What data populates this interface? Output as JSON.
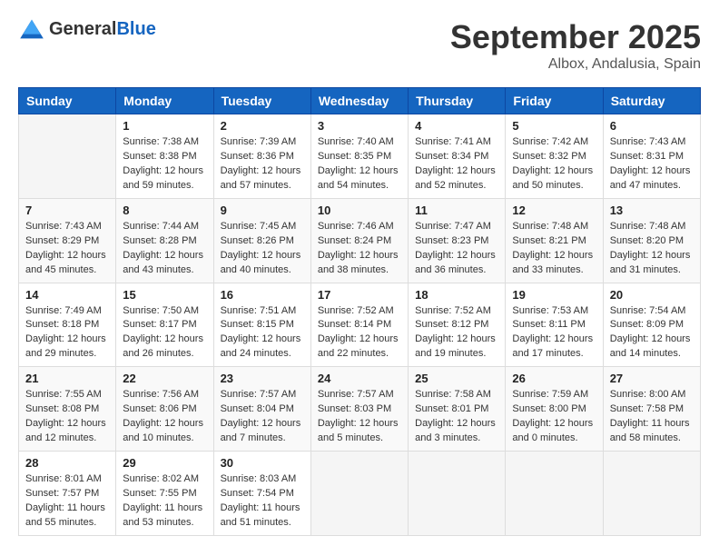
{
  "header": {
    "logo_general": "General",
    "logo_blue": "Blue",
    "month_title": "September 2025",
    "location": "Albox, Andalusia, Spain"
  },
  "days_of_week": [
    "Sunday",
    "Monday",
    "Tuesday",
    "Wednesday",
    "Thursday",
    "Friday",
    "Saturday"
  ],
  "weeks": [
    [
      {
        "day": "",
        "info": ""
      },
      {
        "day": "1",
        "info": "Sunrise: 7:38 AM\nSunset: 8:38 PM\nDaylight: 12 hours\nand 59 minutes."
      },
      {
        "day": "2",
        "info": "Sunrise: 7:39 AM\nSunset: 8:36 PM\nDaylight: 12 hours\nand 57 minutes."
      },
      {
        "day": "3",
        "info": "Sunrise: 7:40 AM\nSunset: 8:35 PM\nDaylight: 12 hours\nand 54 minutes."
      },
      {
        "day": "4",
        "info": "Sunrise: 7:41 AM\nSunset: 8:34 PM\nDaylight: 12 hours\nand 52 minutes."
      },
      {
        "day": "5",
        "info": "Sunrise: 7:42 AM\nSunset: 8:32 PM\nDaylight: 12 hours\nand 50 minutes."
      },
      {
        "day": "6",
        "info": "Sunrise: 7:43 AM\nSunset: 8:31 PM\nDaylight: 12 hours\nand 47 minutes."
      }
    ],
    [
      {
        "day": "7",
        "info": "Sunrise: 7:43 AM\nSunset: 8:29 PM\nDaylight: 12 hours\nand 45 minutes."
      },
      {
        "day": "8",
        "info": "Sunrise: 7:44 AM\nSunset: 8:28 PM\nDaylight: 12 hours\nand 43 minutes."
      },
      {
        "day": "9",
        "info": "Sunrise: 7:45 AM\nSunset: 8:26 PM\nDaylight: 12 hours\nand 40 minutes."
      },
      {
        "day": "10",
        "info": "Sunrise: 7:46 AM\nSunset: 8:24 PM\nDaylight: 12 hours\nand 38 minutes."
      },
      {
        "day": "11",
        "info": "Sunrise: 7:47 AM\nSunset: 8:23 PM\nDaylight: 12 hours\nand 36 minutes."
      },
      {
        "day": "12",
        "info": "Sunrise: 7:48 AM\nSunset: 8:21 PM\nDaylight: 12 hours\nand 33 minutes."
      },
      {
        "day": "13",
        "info": "Sunrise: 7:48 AM\nSunset: 8:20 PM\nDaylight: 12 hours\nand 31 minutes."
      }
    ],
    [
      {
        "day": "14",
        "info": "Sunrise: 7:49 AM\nSunset: 8:18 PM\nDaylight: 12 hours\nand 29 minutes."
      },
      {
        "day": "15",
        "info": "Sunrise: 7:50 AM\nSunset: 8:17 PM\nDaylight: 12 hours\nand 26 minutes."
      },
      {
        "day": "16",
        "info": "Sunrise: 7:51 AM\nSunset: 8:15 PM\nDaylight: 12 hours\nand 24 minutes."
      },
      {
        "day": "17",
        "info": "Sunrise: 7:52 AM\nSunset: 8:14 PM\nDaylight: 12 hours\nand 22 minutes."
      },
      {
        "day": "18",
        "info": "Sunrise: 7:52 AM\nSunset: 8:12 PM\nDaylight: 12 hours\nand 19 minutes."
      },
      {
        "day": "19",
        "info": "Sunrise: 7:53 AM\nSunset: 8:11 PM\nDaylight: 12 hours\nand 17 minutes."
      },
      {
        "day": "20",
        "info": "Sunrise: 7:54 AM\nSunset: 8:09 PM\nDaylight: 12 hours\nand 14 minutes."
      }
    ],
    [
      {
        "day": "21",
        "info": "Sunrise: 7:55 AM\nSunset: 8:08 PM\nDaylight: 12 hours\nand 12 minutes."
      },
      {
        "day": "22",
        "info": "Sunrise: 7:56 AM\nSunset: 8:06 PM\nDaylight: 12 hours\nand 10 minutes."
      },
      {
        "day": "23",
        "info": "Sunrise: 7:57 AM\nSunset: 8:04 PM\nDaylight: 12 hours\nand 7 minutes."
      },
      {
        "day": "24",
        "info": "Sunrise: 7:57 AM\nSunset: 8:03 PM\nDaylight: 12 hours\nand 5 minutes."
      },
      {
        "day": "25",
        "info": "Sunrise: 7:58 AM\nSunset: 8:01 PM\nDaylight: 12 hours\nand 3 minutes."
      },
      {
        "day": "26",
        "info": "Sunrise: 7:59 AM\nSunset: 8:00 PM\nDaylight: 12 hours\nand 0 minutes."
      },
      {
        "day": "27",
        "info": "Sunrise: 8:00 AM\nSunset: 7:58 PM\nDaylight: 11 hours\nand 58 minutes."
      }
    ],
    [
      {
        "day": "28",
        "info": "Sunrise: 8:01 AM\nSunset: 7:57 PM\nDaylight: 11 hours\nand 55 minutes."
      },
      {
        "day": "29",
        "info": "Sunrise: 8:02 AM\nSunset: 7:55 PM\nDaylight: 11 hours\nand 53 minutes."
      },
      {
        "day": "30",
        "info": "Sunrise: 8:03 AM\nSunset: 7:54 PM\nDaylight: 11 hours\nand 51 minutes."
      },
      {
        "day": "",
        "info": ""
      },
      {
        "day": "",
        "info": ""
      },
      {
        "day": "",
        "info": ""
      },
      {
        "day": "",
        "info": ""
      }
    ]
  ]
}
